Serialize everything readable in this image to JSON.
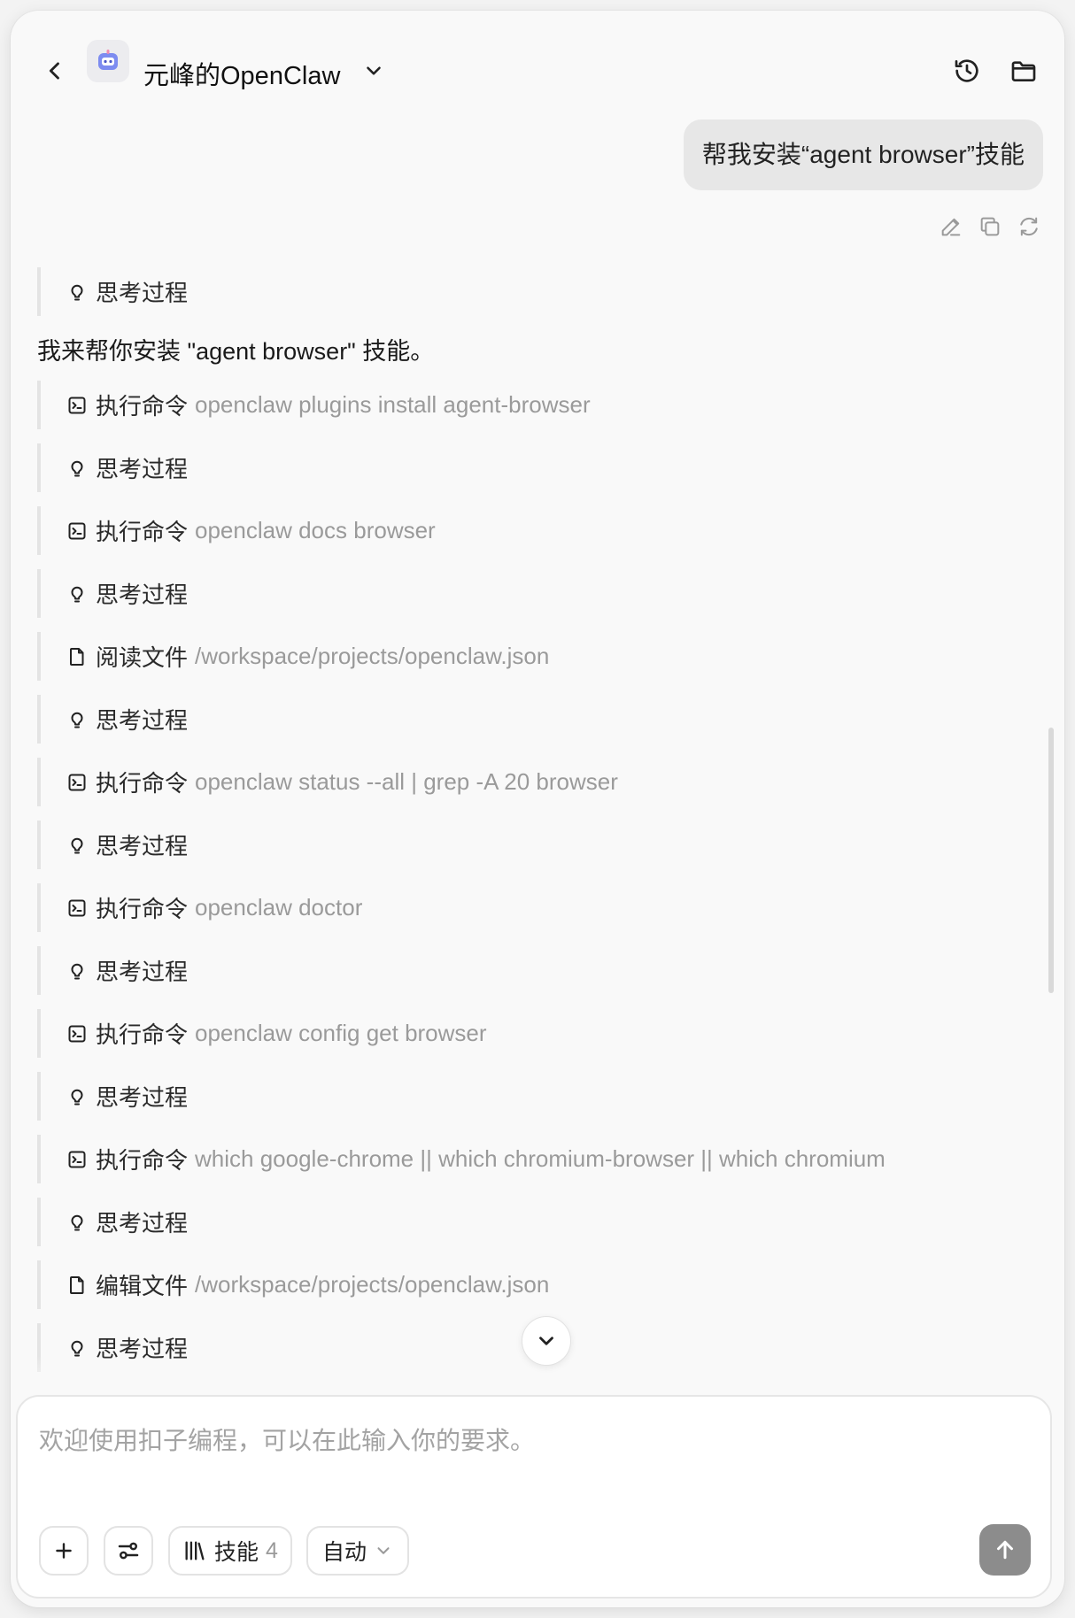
{
  "header": {
    "title": "元峰的OpenClaw"
  },
  "user_message": {
    "text": "帮我安装“agent browser”技能"
  },
  "assistant": {
    "intro": "我来帮你安装 \"agent browser\" 技能。",
    "steps": [
      {
        "kind": "thinking",
        "icon": "lightbulb-icon",
        "label": "思考过程",
        "arg": ""
      },
      {
        "kind": "command",
        "icon": "terminal-icon",
        "label": "执行命令",
        "arg": "openclaw plugins install agent-browser"
      },
      {
        "kind": "thinking",
        "icon": "lightbulb-icon",
        "label": "思考过程",
        "arg": ""
      },
      {
        "kind": "command",
        "icon": "terminal-icon",
        "label": "执行命令",
        "arg": "openclaw docs browser"
      },
      {
        "kind": "thinking",
        "icon": "lightbulb-icon",
        "label": "思考过程",
        "arg": ""
      },
      {
        "kind": "file",
        "icon": "file-icon",
        "label": "阅读文件",
        "arg": "/workspace/projects/openclaw.json"
      },
      {
        "kind": "thinking",
        "icon": "lightbulb-icon",
        "label": "思考过程",
        "arg": ""
      },
      {
        "kind": "command",
        "icon": "terminal-icon",
        "label": "执行命令",
        "arg": "openclaw status --all | grep -A 20 browser"
      },
      {
        "kind": "thinking",
        "icon": "lightbulb-icon",
        "label": "思考过程",
        "arg": ""
      },
      {
        "kind": "command",
        "icon": "terminal-icon",
        "label": "执行命令",
        "arg": "openclaw doctor"
      },
      {
        "kind": "thinking",
        "icon": "lightbulb-icon",
        "label": "思考过程",
        "arg": ""
      },
      {
        "kind": "command",
        "icon": "terminal-icon",
        "label": "执行命令",
        "arg": "openclaw config get browser"
      },
      {
        "kind": "thinking",
        "icon": "lightbulb-icon",
        "label": "思考过程",
        "arg": ""
      },
      {
        "kind": "command",
        "icon": "terminal-icon",
        "label": "执行命令",
        "arg": "which google-chrome || which chromium-browser || which chromium"
      },
      {
        "kind": "thinking",
        "icon": "lightbulb-icon",
        "label": "思考过程",
        "arg": ""
      },
      {
        "kind": "file",
        "icon": "file-icon",
        "label": "编辑文件",
        "arg": "/workspace/projects/openclaw.json"
      },
      {
        "kind": "thinking",
        "icon": "lightbulb-icon",
        "label": "思考过程",
        "arg": ""
      }
    ]
  },
  "composer": {
    "placeholder": "欢迎使用扣子编程，可以在此输入你的要求。",
    "skills_label": "技能",
    "skills_count": "4",
    "mode_label": "自动"
  },
  "colors": {
    "send_button": "#8c8c8c",
    "muted_text": "#9a9a9a",
    "bubble": "#e7e7e7"
  }
}
